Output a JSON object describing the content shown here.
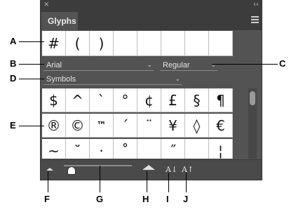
{
  "panel": {
    "title_bar": {
      "close_glyph": "×",
      "collapse_glyph": "‹‹"
    },
    "tab": "Glyphs",
    "recent_glyphs": [
      "#",
      "(",
      ")",
      "",
      "",
      "",
      "",
      ""
    ],
    "font_family": "Arial",
    "font_style": "Regular",
    "category": "Symbols",
    "glyph_rows": [
      [
        "$",
        "^",
        "`",
        "°",
        "¢",
        "£",
        "§",
        "¶"
      ],
      [
        "®",
        "©",
        "™",
        "´",
        "¨",
        "¥",
        "◊",
        "€"
      ],
      [
        "~",
        "˘",
        "·",
        "˚",
        "",
        "˝",
        "",
        "¦"
      ]
    ],
    "dropdown_arrow": "⌄",
    "decrease_size_label": "A↓",
    "increase_size_label": "A↑"
  },
  "callouts": [
    "A",
    "B",
    "C",
    "D",
    "E",
    "F",
    "G",
    "H",
    "I",
    "J"
  ],
  "colors": {
    "panel_bg": "#535353",
    "titlebar_bg": "#3c3c3c",
    "cell_bg": "#ffffff"
  }
}
